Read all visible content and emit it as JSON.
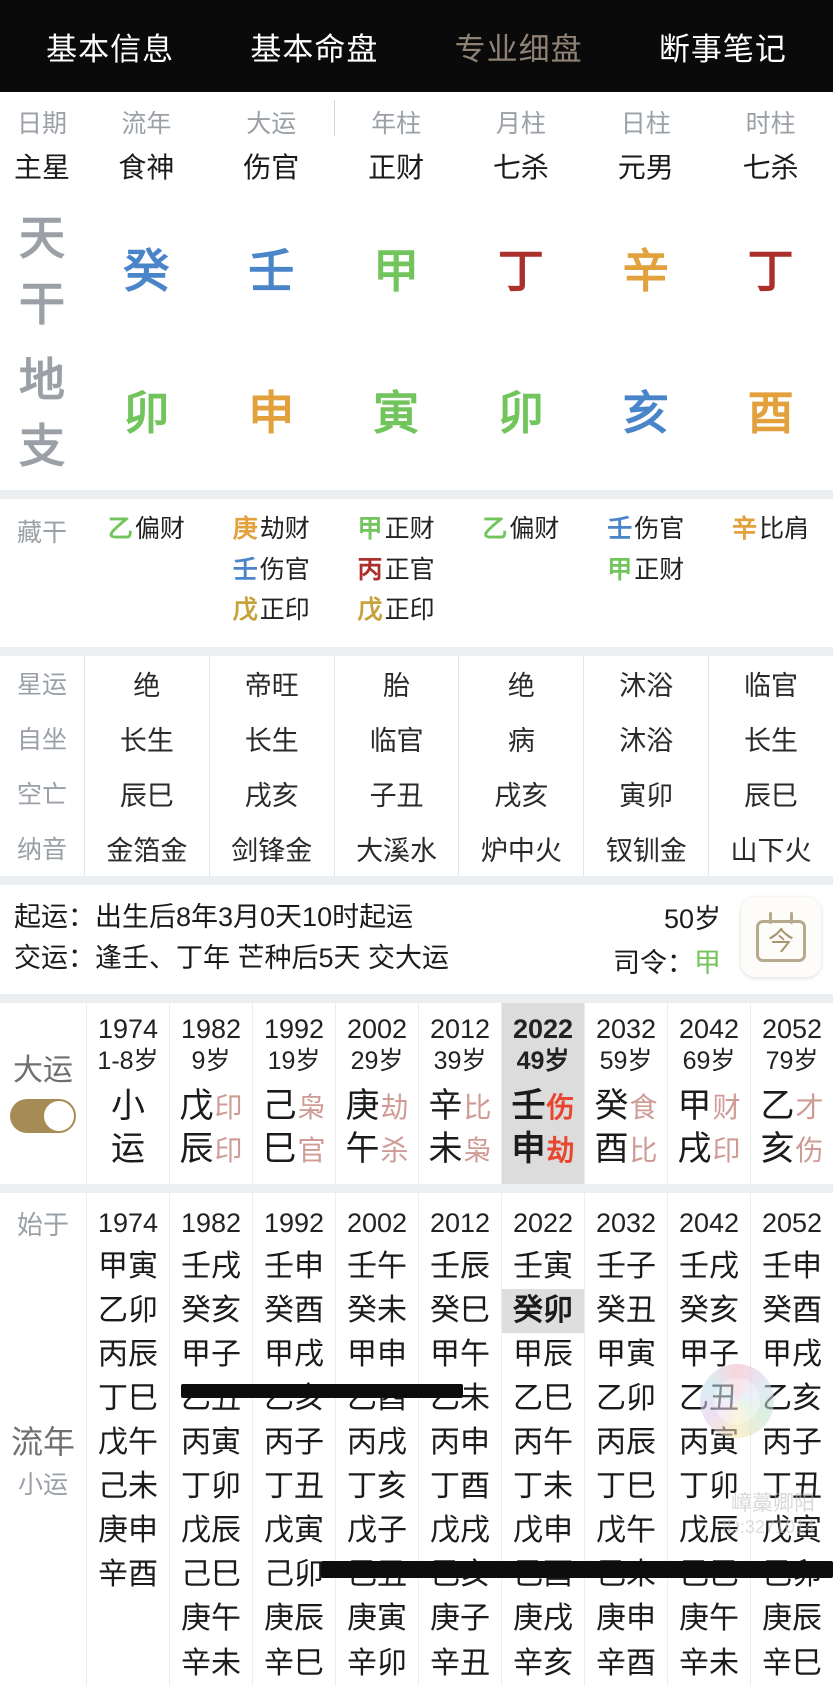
{
  "tabs": [
    {
      "label": "基本信息",
      "active": false,
      "dim": false
    },
    {
      "label": "基本命盘",
      "active": true,
      "dim": false
    },
    {
      "label": "专业细盘",
      "active": false,
      "dim": true
    },
    {
      "label": "断事笔记",
      "active": false,
      "dim": false
    }
  ],
  "pillar_table": {
    "row_labels": {
      "date": "日期",
      "main_star": "主星",
      "heavenly": "天干",
      "earthly": "地支",
      "hidden": "藏干"
    },
    "columns": [
      {
        "header": "流年",
        "main_star": "食神",
        "gan": {
          "char": "癸",
          "element": "water"
        },
        "zhi": {
          "char": "卯",
          "element": "wood"
        },
        "hidden": [
          {
            "g": "乙",
            "ge": "wood",
            "star": "偏财"
          }
        ]
      },
      {
        "header": "大运",
        "main_star": "伤官",
        "gan": {
          "char": "壬",
          "element": "water"
        },
        "zhi": {
          "char": "申",
          "element": "metal"
        },
        "hidden": [
          {
            "g": "庚",
            "ge": "metal",
            "star": "劫财"
          },
          {
            "g": "壬",
            "ge": "water",
            "star": "伤官"
          },
          {
            "g": "戊",
            "ge": "earth",
            "star": "正印"
          }
        ]
      },
      {
        "header": "年柱",
        "main_star": "正财",
        "gan": {
          "char": "甲",
          "element": "wood"
        },
        "zhi": {
          "char": "寅",
          "element": "wood"
        },
        "hidden": [
          {
            "g": "甲",
            "ge": "wood",
            "star": "正财"
          },
          {
            "g": "丙",
            "ge": "fire",
            "star": "正官"
          },
          {
            "g": "戊",
            "ge": "earth",
            "star": "正印"
          }
        ]
      },
      {
        "header": "月柱",
        "main_star": "七杀",
        "gan": {
          "char": "丁",
          "element": "fire"
        },
        "zhi": {
          "char": "卯",
          "element": "wood"
        },
        "hidden": [
          {
            "g": "乙",
            "ge": "wood",
            "star": "偏财"
          }
        ]
      },
      {
        "header": "日柱",
        "main_star": "元男",
        "gan": {
          "char": "辛",
          "element": "metal"
        },
        "zhi": {
          "char": "亥",
          "element": "water"
        },
        "hidden": [
          {
            "g": "壬",
            "ge": "water",
            "star": "伤官"
          },
          {
            "g": "甲",
            "ge": "wood",
            "star": "正财"
          }
        ]
      },
      {
        "header": "时柱",
        "main_star": "七杀",
        "gan": {
          "char": "丁",
          "element": "fire"
        },
        "zhi": {
          "char": "酉",
          "element": "metal"
        },
        "hidden": [
          {
            "g": "辛",
            "ge": "metal",
            "star": "比肩"
          }
        ]
      }
    ]
  },
  "star_block": {
    "labels": [
      "星运",
      "自坐",
      "空亡",
      "纳音"
    ],
    "columns": [
      {
        "xingyun": "绝",
        "zizuo": "长生",
        "kongwang": "辰巳",
        "nayin": "金箔金"
      },
      {
        "xingyun": "帝旺",
        "zizuo": "长生",
        "kongwang": "戌亥",
        "nayin": "剑锋金"
      },
      {
        "xingyun": "胎",
        "zizuo": "临官",
        "kongwang": "子丑",
        "nayin": "大溪水"
      },
      {
        "xingyun": "绝",
        "zizuo": "病",
        "kongwang": "戌亥",
        "nayin": "炉中火"
      },
      {
        "xingyun": "沐浴",
        "zizuo": "沐浴",
        "kongwang": "寅卯",
        "nayin": "钗钏金"
      },
      {
        "xingyun": "临官",
        "zizuo": "长生",
        "kongwang": "辰巳",
        "nayin": "山下火"
      }
    ]
  },
  "start_luck": {
    "qiyun_label": "起运：",
    "qiyun_value": "出生后8年3月0天10时起运",
    "jiaoyun_label": "交运：",
    "jiaoyun_value": "逢壬、丁年 芒种后5天 交大运",
    "age": "50岁",
    "siling_label": "司令：",
    "siling_value": "甲",
    "siling_element": "wood",
    "today_button": "今"
  },
  "dayun": {
    "title": "大运",
    "toggle_on": true,
    "cells": [
      {
        "year": "1974",
        "age": "1-8岁",
        "type": "xiaoyun",
        "lines": [
          "小",
          "运"
        ],
        "selected": false
      },
      {
        "year": "1982",
        "age": "9岁",
        "type": "gz",
        "gan": "戊",
        "gan_star": "印",
        "zhi": "辰",
        "zhi_star": "印",
        "selected": false
      },
      {
        "year": "1992",
        "age": "19岁",
        "type": "gz",
        "gan": "己",
        "gan_star": "枭",
        "zhi": "巳",
        "zhi_star": "官",
        "selected": false
      },
      {
        "year": "2002",
        "age": "29岁",
        "type": "gz",
        "gan": "庚",
        "gan_star": "劫",
        "zhi": "午",
        "zhi_star": "杀",
        "selected": false
      },
      {
        "year": "2012",
        "age": "39岁",
        "type": "gz",
        "gan": "辛",
        "gan_star": "比",
        "zhi": "未",
        "zhi_star": "枭",
        "selected": false
      },
      {
        "year": "2022",
        "age": "49岁",
        "type": "gz",
        "gan": "壬",
        "gan_star": "伤",
        "zhi": "申",
        "zhi_star": "劫",
        "selected": true
      },
      {
        "year": "2032",
        "age": "59岁",
        "type": "gz",
        "gan": "癸",
        "gan_star": "食",
        "zhi": "酉",
        "zhi_star": "比",
        "selected": false
      },
      {
        "year": "2042",
        "age": "69岁",
        "type": "gz",
        "gan": "甲",
        "gan_star": "财",
        "zhi": "戌",
        "zhi_star": "印",
        "selected": false
      },
      {
        "year": "2052",
        "age": "79岁",
        "type": "gz",
        "gan": "乙",
        "gan_star": "才",
        "zhi": "亥",
        "zhi_star": "伤",
        "selected": false
      }
    ]
  },
  "liunian": {
    "start_label": "始于",
    "title": "流年",
    "subtitle": "小运",
    "columns": [
      {
        "year": "1974",
        "items": [
          "甲寅",
          "乙卯",
          "丙辰",
          "丁巳",
          "戊午",
          "己未",
          "庚申",
          "辛酉"
        ],
        "highlight": null
      },
      {
        "year": "1982",
        "items": [
          "壬戌",
          "癸亥",
          "甲子",
          "乙丑",
          "丙寅",
          "丁卯",
          "戊辰",
          "己巳",
          "庚午",
          "辛未"
        ],
        "highlight": null
      },
      {
        "year": "1992",
        "items": [
          "壬申",
          "癸酉",
          "甲戌",
          "乙亥",
          "丙子",
          "丁丑",
          "戊寅",
          "己卯",
          "庚辰",
          "辛巳"
        ],
        "highlight": null
      },
      {
        "year": "2002",
        "items": [
          "壬午",
          "癸未",
          "甲申",
          "乙酉",
          "丙戌",
          "丁亥",
          "戊子",
          "己丑",
          "庚寅",
          "辛卯"
        ],
        "highlight": null
      },
      {
        "year": "2012",
        "items": [
          "壬辰",
          "癸巳",
          "甲午",
          "乙未",
          "丙申",
          "丁酉",
          "戊戌",
          "己亥",
          "庚子",
          "辛丑"
        ],
        "highlight": null
      },
      {
        "year": "2022",
        "items": [
          "壬寅",
          "癸卯",
          "甲辰",
          "乙巳",
          "丙午",
          "丁未",
          "戊申",
          "己酉",
          "庚戌",
          "辛亥"
        ],
        "highlight": "癸卯"
      },
      {
        "year": "2032",
        "items": [
          "壬子",
          "癸丑",
          "甲寅",
          "乙卯",
          "丙辰",
          "丁巳",
          "戊午",
          "己未",
          "庚申",
          "辛酉"
        ],
        "highlight": null
      },
      {
        "year": "2042",
        "items": [
          "壬戌",
          "癸亥",
          "甲子",
          "乙丑",
          "丙寅",
          "丁卯",
          "戊辰",
          "己巳",
          "庚午",
          "辛未"
        ],
        "highlight": null
      },
      {
        "year": "2052",
        "items": [
          "壬申",
          "癸酉",
          "甲戌",
          "乙亥",
          "丙子",
          "丁丑",
          "戊寅",
          "己卯",
          "庚辰",
          "辛巳"
        ],
        "highlight": null
      }
    ]
  },
  "watermark": {
    "line1": "嶂藁卿阳",
    "line2": "ID:3271014"
  },
  "colors": {
    "wood": "#72c55c",
    "fire": "#ab2f2b",
    "earth": "#c6a23c",
    "metal": "#e2a13c",
    "water": "#4a84c9",
    "accent": "#a78b55",
    "selected_bg": "#dcdcdc",
    "tab_dim": "#8e8275"
  }
}
